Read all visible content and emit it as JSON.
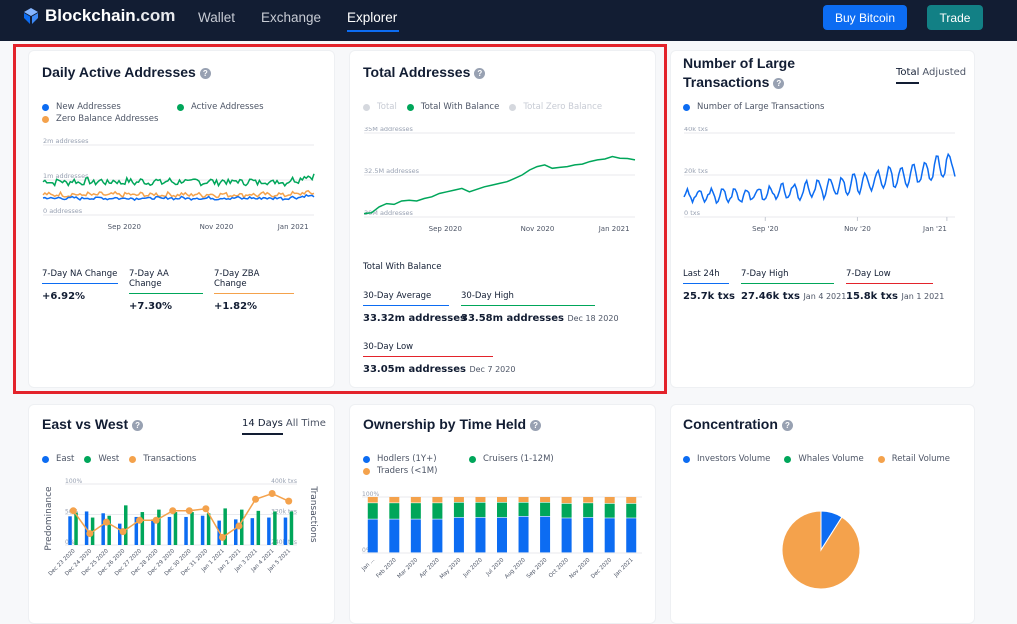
{
  "nav": {
    "brand": "Blockchain",
    "brand_suffix": ".com",
    "links": [
      "Wallet",
      "Exchange",
      "Explorer"
    ],
    "active_link": "Explorer",
    "buy_button": "Buy Bitcoin",
    "trade_button": "Trade"
  },
  "colors": {
    "blue": "#0c6cf2",
    "green": "#00a65a",
    "orange": "#f4a24c",
    "red": "#e3232b",
    "grey": "#c7cbd4"
  },
  "daily_active": {
    "title": "Daily Active Addresses",
    "legend": [
      "New Addresses",
      "Active Addresses",
      "Zero Balance Addresses"
    ],
    "stats": [
      {
        "label": "7-Day NA Change",
        "value": "+6.92%"
      },
      {
        "label": "7-Day AA Change",
        "value": "+7.30%"
      },
      {
        "label": "7-Day ZBA Change",
        "value": "+1.82%"
      }
    ]
  },
  "total_addresses": {
    "title": "Total Addresses",
    "legend": [
      "Total",
      "Total With Balance",
      "Total Zero Balance"
    ],
    "subtitle": "Total With Balance",
    "stats": [
      {
        "label": "30-Day Average",
        "value": "33.32m addresses",
        "date": ""
      },
      {
        "label": "30-Day High",
        "value": "33.58m addresses",
        "date": "Dec 18 2020"
      },
      {
        "label": "30-Day Low",
        "value": "33.05m addresses",
        "date": "Dec 7 2020"
      }
    ]
  },
  "large_tx": {
    "title_line1": "Number of Large",
    "title_line2": "Transactions",
    "tabs": [
      "Total",
      "Adjusted"
    ],
    "active_tab": "Total",
    "legend": [
      "Number of Large Transactions"
    ],
    "stats": [
      {
        "label": "Last 24h",
        "value": "25.7k txs",
        "date": ""
      },
      {
        "label": "7-Day High",
        "value": "27.46k txs",
        "date": "Jan 4 2021"
      },
      {
        "label": "7-Day Low",
        "value": "15.8k txs",
        "date": "Jan 1 2021"
      }
    ]
  },
  "east_west": {
    "title": "East vs West",
    "tabs": [
      "14 Days",
      "All Time"
    ],
    "active_tab": "14 Days",
    "legend": [
      "East",
      "West",
      "Transactions"
    ]
  },
  "ownership": {
    "title": "Ownership by Time Held",
    "legend": [
      "Hodlers (1Y+)",
      "Cruisers (1-12M)",
      "Traders (<1M)"
    ]
  },
  "concentration": {
    "title": "Concentration",
    "legend": [
      "Investors Volume",
      "Whales Volume",
      "Retail Volume"
    ]
  },
  "chart_data": [
    {
      "id": "daily_active",
      "type": "line",
      "title": "Daily Active Addresses",
      "ylim": [
        0,
        2000000
      ],
      "y_ticks": [
        "0 addresses",
        "1m addresses",
        "2m addresses"
      ],
      "x_ticks": [
        "Sep 2020",
        "Nov 2020",
        "Jan 2021"
      ],
      "series": [
        {
          "name": "Active Addresses",
          "color": "#00a65a",
          "mean": 950000,
          "amp": 90000,
          "end": 1150000
        },
        {
          "name": "Zero Balance Addresses",
          "color": "#f4a24c",
          "mean": 580000,
          "amp": 60000,
          "end": 650000
        },
        {
          "name": "New Addresses",
          "color": "#0c6cf2",
          "mean": 480000,
          "amp": 40000,
          "end": 560000
        }
      ]
    },
    {
      "id": "total_addresses",
      "type": "line",
      "title": "Total Addresses",
      "ylim": [
        30000000,
        35000000
      ],
      "y_ticks": [
        "30M addresses",
        "32.5M addresses",
        "35M addresses"
      ],
      "x_ticks": [
        "Sep 2020",
        "Nov 2020",
        "Jan 2021"
      ],
      "series": [
        {
          "name": "Total With Balance",
          "color": "#00a65a",
          "values": [
            30.2,
            30.25,
            30.6,
            30.8,
            30.75,
            30.95,
            31.0,
            30.95,
            31.1,
            31.2,
            31.4,
            31.5,
            31.6,
            31.7,
            31.5,
            31.65,
            31.8,
            31.9,
            32.0,
            32.1,
            32.3,
            32.5,
            32.8,
            33.0,
            33.1,
            32.9,
            32.95,
            33.0,
            33.1,
            33.15,
            33.3,
            33.4,
            33.45,
            33.6,
            33.5,
            33.48,
            33.4
          ]
        }
      ]
    },
    {
      "id": "large_tx",
      "type": "line",
      "title": "Number of Large Transactions",
      "ylim": [
        0,
        40000
      ],
      "y_ticks": [
        "0 txs",
        "20k txs",
        "40k txs"
      ],
      "x_ticks": [
        "Sep '20",
        "Nov '20",
        "Jan '21"
      ],
      "series": [
        {
          "name": "Number of Large Transactions",
          "color": "#0c6cf2",
          "start": 10000,
          "end": 25700,
          "amp": 3000
        }
      ]
    },
    {
      "id": "east_west",
      "type": "bar",
      "title": "East vs West",
      "categories": [
        "Dec 23 2020",
        "Dec 24 2020",
        "Dec 25 2020",
        "Dec 26 2020",
        "Dec 27 2020",
        "Dec 28 2020",
        "Dec 29 2020",
        "Dec 30 2020",
        "Dec 31 2020",
        "Jan 1 2021",
        "Jan 2 2021",
        "Jan 3 2021",
        "Jan 4 2021",
        "Jan 5 2021"
      ],
      "y_left_label": "Predominance",
      "y_right_label": "Transactions",
      "y_left_ticks": [
        "0%",
        "50%",
        "100%"
      ],
      "y_right_ticks": [
        "240k txs",
        "320k txs",
        "400k txs"
      ],
      "series": [
        {
          "name": "East",
          "color": "#0c6cf2",
          "values": [
            47,
            55,
            52,
            35,
            46,
            42,
            46,
            46,
            48,
            40,
            42,
            44,
            45,
            45
          ]
        },
        {
          "name": "West",
          "color": "#00a65a",
          "values": [
            53,
            45,
            48,
            65,
            54,
            58,
            54,
            54,
            52,
            60,
            58,
            56,
            55,
            55
          ]
        },
        {
          "name": "Transactions",
          "color": "#f4a24c",
          "type": "line",
          "values": [
            330000,
            270000,
            300000,
            275000,
            305000,
            305000,
            330000,
            330000,
            335000,
            260000,
            290000,
            360000,
            375000,
            355000
          ]
        }
      ]
    },
    {
      "id": "ownership",
      "type": "bar",
      "stacked": true,
      "title": "Ownership by Time Held",
      "categories": [
        "Jan ...",
        "Feb 2020",
        "Mar 2020",
        "Apr 2020",
        "May 2020",
        "Jun 2020",
        "Jul 2020",
        "Aug 2020",
        "Sep 2020",
        "Oct 2020",
        "Nov 2020",
        "Dec 2020",
        "Jan 2021"
      ],
      "y_ticks": [
        "0%",
        "100%"
      ],
      "series": [
        {
          "name": "Hodlers (1Y+)",
          "color": "#0c6cf2",
          "values": [
            60,
            60,
            60,
            60,
            63,
            63,
            63,
            65,
            65,
            62,
            63,
            62,
            62
          ]
        },
        {
          "name": "Cruisers (1-12M)",
          "color": "#00a65a",
          "values": [
            29,
            29,
            29,
            29,
            27,
            27,
            27,
            25,
            25,
            26,
            26,
            26,
            26
          ]
        },
        {
          "name": "Traders (<1M)",
          "color": "#f4a24c",
          "values": [
            11,
            11,
            11,
            11,
            10,
            10,
            10,
            10,
            10,
            12,
            11,
            12,
            12
          ]
        }
      ]
    },
    {
      "id": "concentration",
      "type": "pie",
      "title": "Concentration",
      "series": [
        {
          "name": "Investors Volume",
          "color": "#0c6cf2",
          "value": 9
        },
        {
          "name": "Whales Volume",
          "color": "#00a65a",
          "value": 0
        },
        {
          "name": "Retail Volume",
          "color": "#f4a24c",
          "value": 91
        }
      ]
    }
  ]
}
